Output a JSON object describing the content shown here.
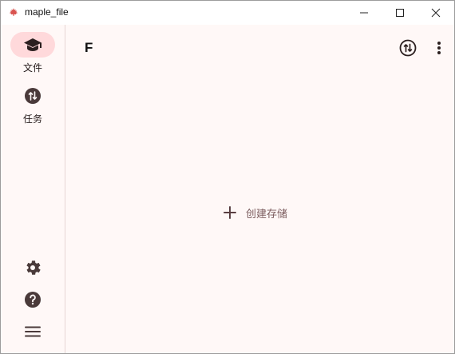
{
  "window": {
    "title": "maple_file",
    "controls": {
      "minimize": "minimize",
      "maximize": "maximize",
      "close": "close"
    }
  },
  "rail": {
    "items": [
      {
        "label": "文件",
        "icon": "graduation-cap-icon",
        "active": true
      },
      {
        "label": "任务",
        "icon": "transfer-icon",
        "active": false
      }
    ],
    "bottom": [
      {
        "icon": "gear-icon"
      },
      {
        "icon": "help-icon"
      },
      {
        "icon": "menu-icon"
      }
    ]
  },
  "main": {
    "title": "F",
    "actions": [
      {
        "icon": "sync-transfer-icon"
      },
      {
        "icon": "more-vertical-icon"
      }
    ],
    "empty_state": {
      "icon": "plus-icon",
      "label": "创建存储"
    }
  },
  "colors": {
    "background": "#fff8f7",
    "rail_active": "#ffd9db",
    "icon": "#4a3a3a",
    "accent_text": "#7a5a5c",
    "maple": "#d9534f"
  }
}
